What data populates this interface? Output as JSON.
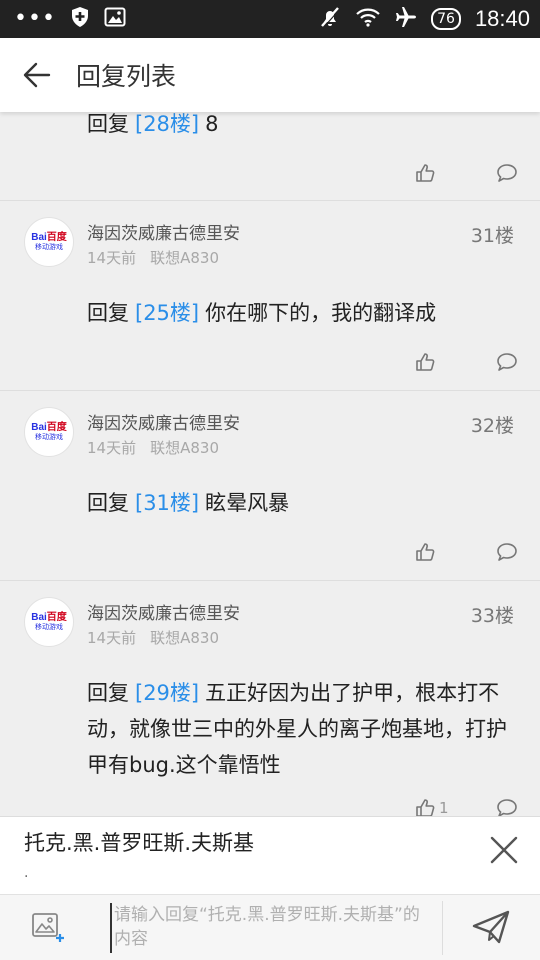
{
  "status_bar": {
    "dots": "•••",
    "battery": "76",
    "time": "18:40"
  },
  "header": {
    "title": "回复列表"
  },
  "posts": [
    {
      "reply_prefix": "回复",
      "reply_ref": "[28楼]",
      "text": "8",
      "likes": ""
    },
    {
      "username": "海因茨威廉古德里安",
      "time_ago": "14天前",
      "device": "联想A830",
      "floor": "31楼",
      "reply_prefix": "回复",
      "reply_ref": "[25楼]",
      "text": "你在哪下的，我的翻译成",
      "likes": ""
    },
    {
      "username": "海因茨威廉古德里安",
      "time_ago": "14天前",
      "device": "联想A830",
      "floor": "32楼",
      "reply_prefix": "回复",
      "reply_ref": "[31楼]",
      "text": "眩晕风暴",
      "likes": ""
    },
    {
      "username": "海因茨威廉古德里安",
      "time_ago": "14天前",
      "device": "联想A830",
      "floor": "33楼",
      "reply_prefix": "回复",
      "reply_ref": "[29楼]",
      "text": "五正好因为出了护甲，根本打不动，就像世三中的外星人的离子炮基地，打护甲有bug.这个靠悟性",
      "likes": "1"
    }
  ],
  "avatar_logo": {
    "line1_a": "Bai",
    "line1_b": "百度",
    "line2": "移动游戏"
  },
  "reply_target": {
    "name": "托克.黑.普罗旺斯.夫斯基",
    "dot": "."
  },
  "input": {
    "placeholder": "请输入回复“托克.黑.普罗旺斯.夫斯基”的内容",
    "value": ""
  },
  "colors": {
    "link": "#2a8ee8",
    "status_bar": "#222222",
    "background": "#efefef"
  },
  "icons": [
    "back-arrow-icon",
    "thumbs-up-icon",
    "comment-bubble-icon",
    "close-icon",
    "image-add-icon",
    "send-icon"
  ]
}
